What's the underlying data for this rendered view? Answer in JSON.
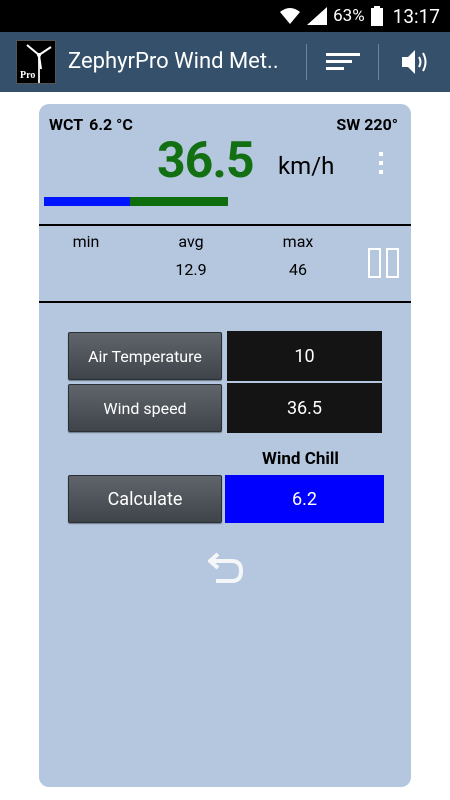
{
  "status_bar": {
    "battery_percent": "63%",
    "time": "13:17"
  },
  "action_bar": {
    "title": "ZephyrPro Wind Met..",
    "app_icon_label": "Pro"
  },
  "header": {
    "wct_label": "WCT",
    "wct_value": "6.2 °C",
    "direction": "SW 220°",
    "speed": "36.5",
    "unit": "km/h",
    "speed_bar": {
      "blue_fraction": 0.47,
      "green_fraction": 0.53
    }
  },
  "stats": {
    "min_label": "min",
    "avg_label": "avg",
    "max_label": "max",
    "min_value": "",
    "avg_value": "12.9",
    "max_value": "46"
  },
  "calculator": {
    "air_temp_label": "Air Temperature",
    "air_temp_value": "10",
    "wind_speed_label": "Wind speed",
    "wind_speed_value": "36.5",
    "result_label": "Wind Chill",
    "calculate_label": "Calculate",
    "result_value": "6.2",
    "result_color": "#0000ff"
  },
  "colors": {
    "action_bar": "#34506a",
    "panel": "#b4c7df",
    "speed_text": "#127012"
  }
}
